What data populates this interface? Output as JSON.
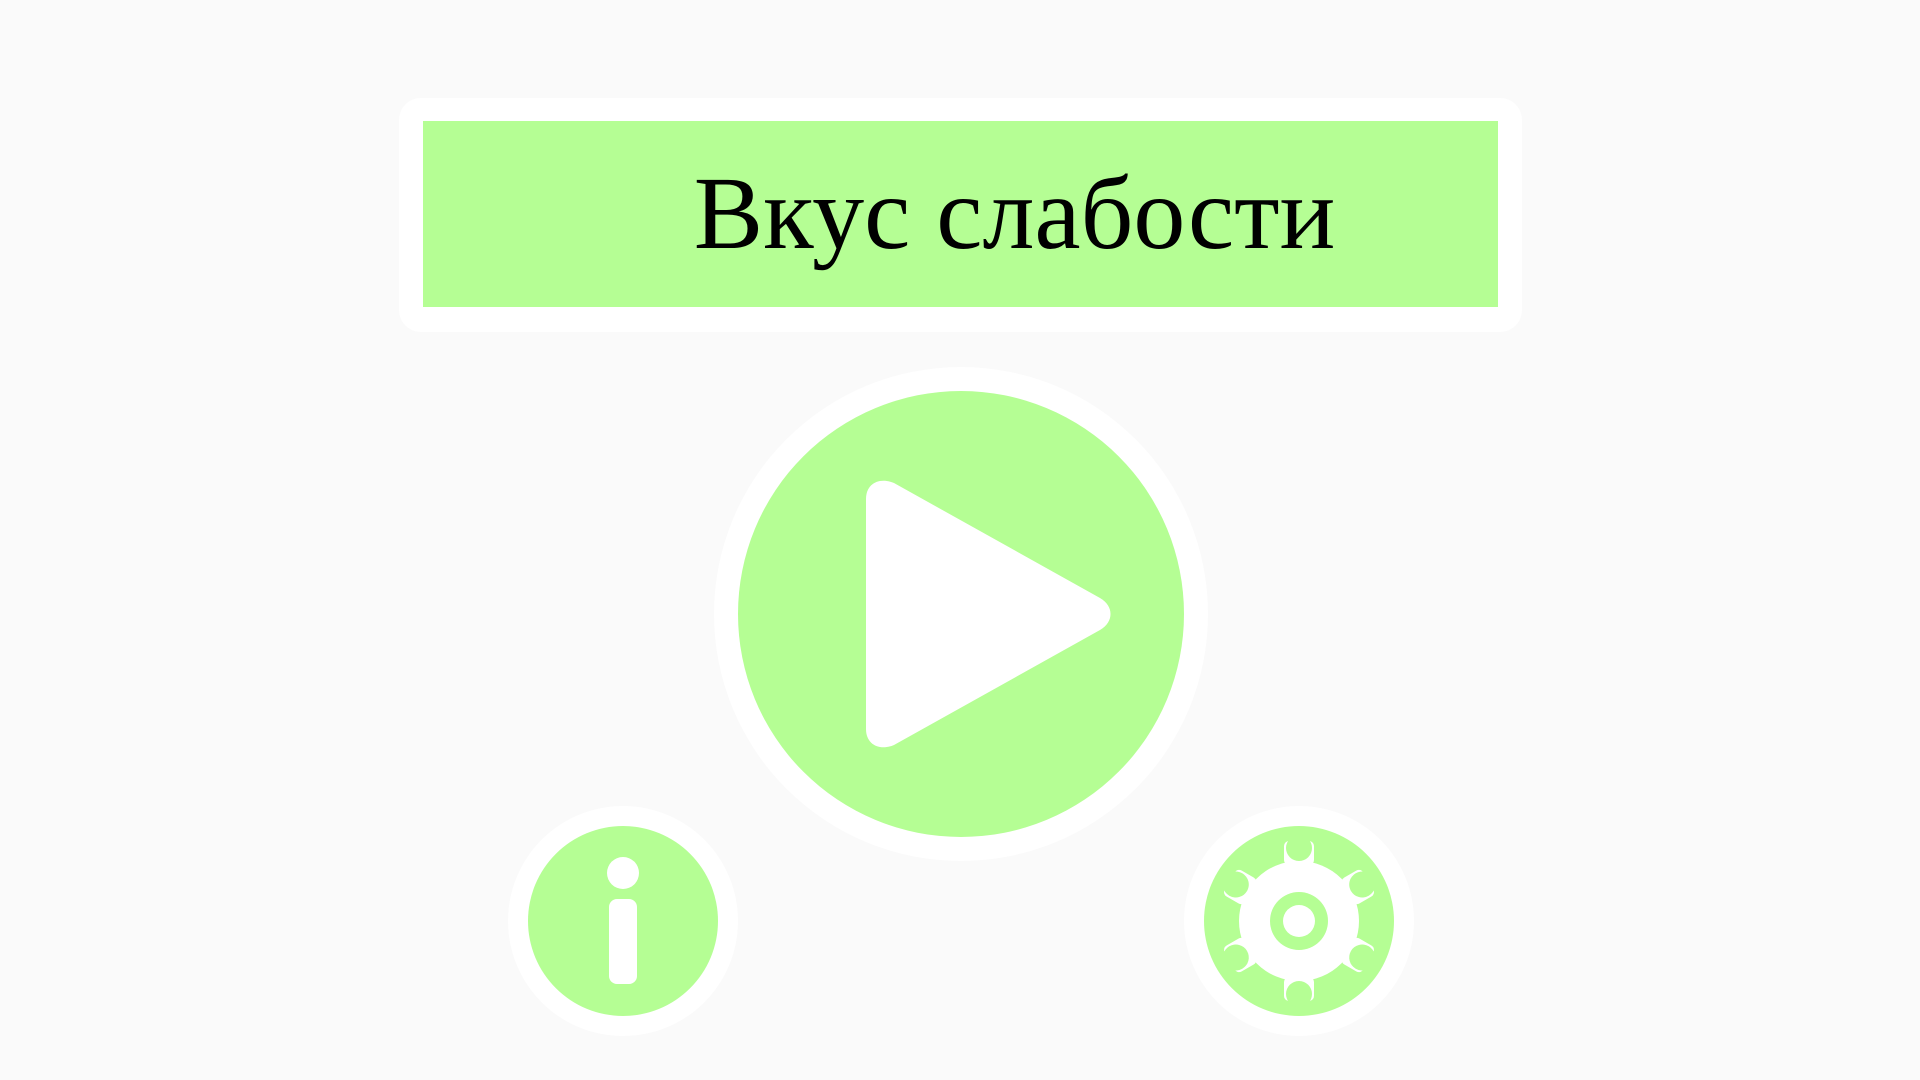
{
  "title": "Вкус слабости",
  "icons": {
    "play": "play-icon",
    "info": "info-icon",
    "settings": "gear-icon"
  },
  "colors": {
    "background": "#fafafa",
    "accent": "#b5fe94",
    "frame": "#ffffff",
    "text": "#000000"
  }
}
